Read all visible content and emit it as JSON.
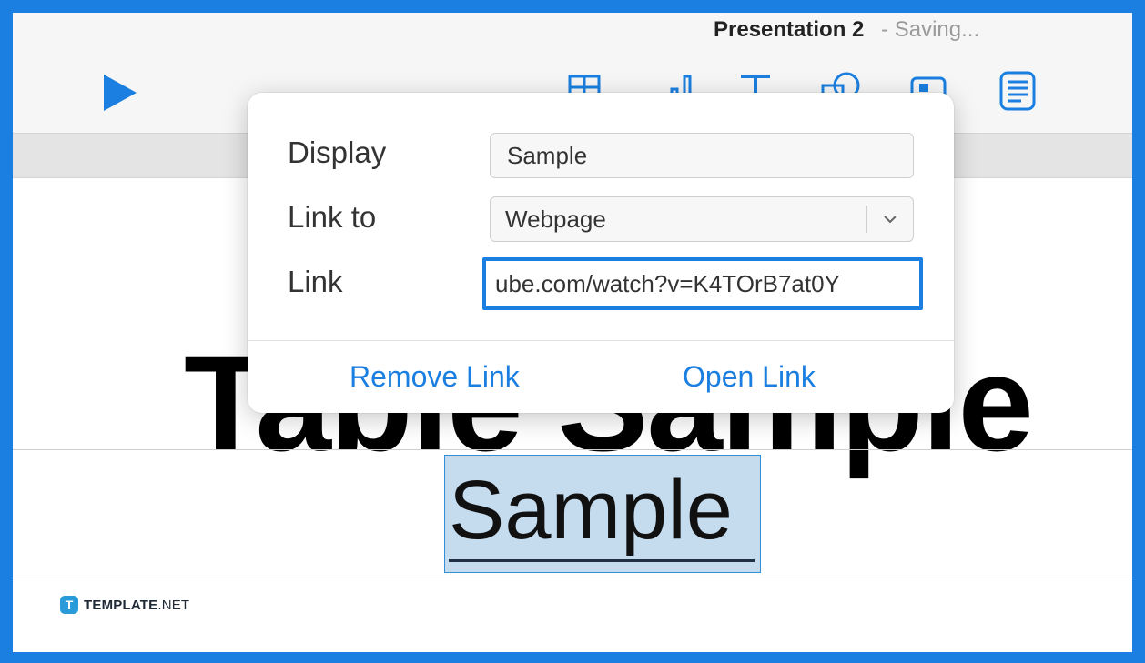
{
  "window": {
    "doc_title": "Presentation 2",
    "save_status": "- Saving..."
  },
  "toolbar": {
    "icons": [
      "play-icon",
      "table-icon",
      "chart-icon",
      "text-icon",
      "shape-icon",
      "media-icon",
      "comment-icon"
    ],
    "accent_color": "#1a7fe0"
  },
  "slide": {
    "title": "Table Sample",
    "selected_text": "Sample"
  },
  "link_popover": {
    "display_label": "Display",
    "display_value": "Sample",
    "link_to_label": "Link to",
    "link_to_value": "Webpage",
    "link_label": "Link",
    "link_value": "ube.com/watch?v=K4TOrB7at0Y",
    "remove_link": "Remove Link",
    "open_link": "Open Link"
  },
  "watermark": {
    "logo_letter": "T",
    "brand_bold": "TEMPLATE",
    "brand_suffix": ".NET"
  }
}
